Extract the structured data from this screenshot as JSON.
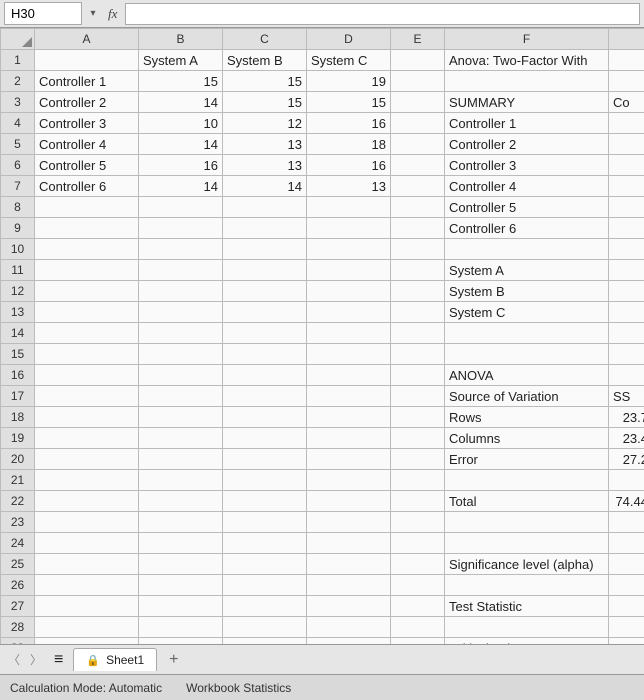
{
  "namebox": {
    "value": "H30"
  },
  "fx_label": "fx",
  "columns": [
    "A",
    "B",
    "C",
    "D",
    "E",
    "F"
  ],
  "row_count": 30,
  "cells": {
    "B1": "System A",
    "C1": "System B",
    "D1": "System C",
    "F1": "Anova: Two-Factor With",
    "A2": "Controller 1",
    "B2": "15",
    "C2": "15",
    "D2": "19",
    "A3": "Controller 2",
    "B3": "14",
    "C3": "15",
    "D3": "15",
    "F3": "SUMMARY",
    "G3": "Co",
    "A4": "Controller 3",
    "B4": "10",
    "C4": "12",
    "D4": "16",
    "F4": "Controller 1",
    "A5": "Controller 4",
    "B5": "14",
    "C5": "13",
    "D5": "18",
    "F5": "Controller 2",
    "A6": "Controller 5",
    "B6": "16",
    "C6": "13",
    "D6": "16",
    "F6": "Controller 3",
    "A7": "Controller 6",
    "B7": "14",
    "C7": "14",
    "D7": "13",
    "F7": "Controller 4",
    "F8": "Controller 5",
    "F9": "Controller 6",
    "F11": "System A",
    "F12": "System B",
    "F13": "System C",
    "F16": "ANOVA",
    "F17": "Source of Variation",
    "G17": "SS",
    "F18": "Rows",
    "G18": "23.7",
    "F19": "Columns",
    "G19": "23.4",
    "F20": "Error",
    "G20": "27.2",
    "F22": "Total",
    "G22": "74.44",
    "F25": "Significance level (alpha)",
    "F27": "Test Statistic",
    "F29": "Critical Value"
  },
  "numeric_cols": [
    "B",
    "C",
    "D",
    "G"
  ],
  "tabs": {
    "active": "Sheet1"
  },
  "statusbar": {
    "calc_mode": "Calculation Mode: Automatic",
    "wb_stats": "Workbook Statistics"
  },
  "chart_data": {
    "type": "table",
    "title": "Anova: Two-Factor Without Replication (partial view)",
    "data_table": {
      "columns": [
        "System A",
        "System B",
        "System C"
      ],
      "rows": [
        "Controller 1",
        "Controller 2",
        "Controller 3",
        "Controller 4",
        "Controller 5",
        "Controller 6"
      ],
      "values": [
        [
          15,
          15,
          19
        ],
        [
          14,
          15,
          15
        ],
        [
          10,
          12,
          16
        ],
        [
          14,
          13,
          18
        ],
        [
          16,
          13,
          16
        ],
        [
          14,
          14,
          13
        ]
      ]
    },
    "anova": {
      "source_of_variation": [
        "Rows",
        "Columns",
        "Error",
        "Total"
      ],
      "SS": [
        23.7,
        23.4,
        27.2,
        74.44
      ]
    }
  }
}
